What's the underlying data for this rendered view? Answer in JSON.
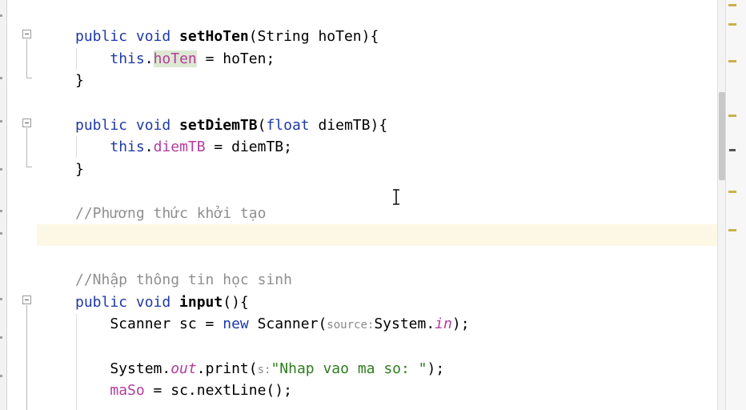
{
  "editor": {
    "lines": [
      [
        {
          "t": "public ",
          "c": "kw"
        },
        {
          "t": "void ",
          "c": "kw"
        },
        {
          "t": "setHoTen",
          "c": "bold"
        },
        {
          "t": "(String hoTen){",
          "c": ""
        }
      ],
      [
        {
          "t": "    ",
          "c": ""
        },
        {
          "t": "this",
          "c": "kw"
        },
        {
          "t": ".",
          "c": ""
        },
        {
          "t": "hoTen",
          "c": "field mark"
        },
        {
          "t": " = hoTen;",
          "c": ""
        }
      ],
      [
        {
          "t": "}",
          "c": ""
        }
      ],
      [],
      [
        {
          "t": "public ",
          "c": "kw"
        },
        {
          "t": "void ",
          "c": "kw"
        },
        {
          "t": "setDiemTB",
          "c": "bold"
        },
        {
          "t": "(",
          "c": ""
        },
        {
          "t": "float",
          "c": "kw"
        },
        {
          "t": " diemTB){",
          "c": ""
        }
      ],
      [
        {
          "t": "    ",
          "c": ""
        },
        {
          "t": "this",
          "c": "kw"
        },
        {
          "t": ".",
          "c": ""
        },
        {
          "t": "diemTB",
          "c": "field"
        },
        {
          "t": " = diemTB;",
          "c": ""
        }
      ],
      [
        {
          "t": "}",
          "c": ""
        }
      ],
      [],
      [
        {
          "t": "//Phương thức khởi tạo",
          "c": "comment"
        }
      ],
      [],
      [],
      [
        {
          "t": "//Nhập thông tin học sinh",
          "c": "comment"
        }
      ],
      [
        {
          "t": "public ",
          "c": "kw"
        },
        {
          "t": "void ",
          "c": "kw"
        },
        {
          "t": "input",
          "c": "bold"
        },
        {
          "t": "(){",
          "c": ""
        }
      ],
      [
        {
          "t": "    Scanner sc = ",
          "c": ""
        },
        {
          "t": "new",
          "c": "kw"
        },
        {
          "t": " Scanner(",
          "c": ""
        },
        {
          "t": "source:",
          "c": "hint"
        },
        {
          "t": "System.",
          "c": ""
        },
        {
          "t": "in",
          "c": "italic-field"
        },
        {
          "t": ");",
          "c": ""
        }
      ],
      [],
      [
        {
          "t": "    System.",
          "c": ""
        },
        {
          "t": "out",
          "c": "italic-field"
        },
        {
          "t": ".print(",
          "c": ""
        },
        {
          "t": "s:",
          "c": "hint"
        },
        {
          "t": "\"Nhap vao ma so: \"",
          "c": "string"
        },
        {
          "t": ");",
          "c": ""
        }
      ],
      [
        {
          "t": "    ",
          "c": ""
        },
        {
          "t": "maSo",
          "c": "field"
        },
        {
          "t": " = sc.nextLine();",
          "c": ""
        }
      ]
    ]
  },
  "icons": {
    "fold": "fold-collapse-icon",
    "cursor": "text-cursor-icon"
  },
  "colors": {
    "keyword": "#1f39a8",
    "field": "#b33c9e",
    "comment": "#8f8f8f",
    "string": "#2e7d1e",
    "current_line": "#fdf8e6",
    "marker": "#c9b24a"
  }
}
